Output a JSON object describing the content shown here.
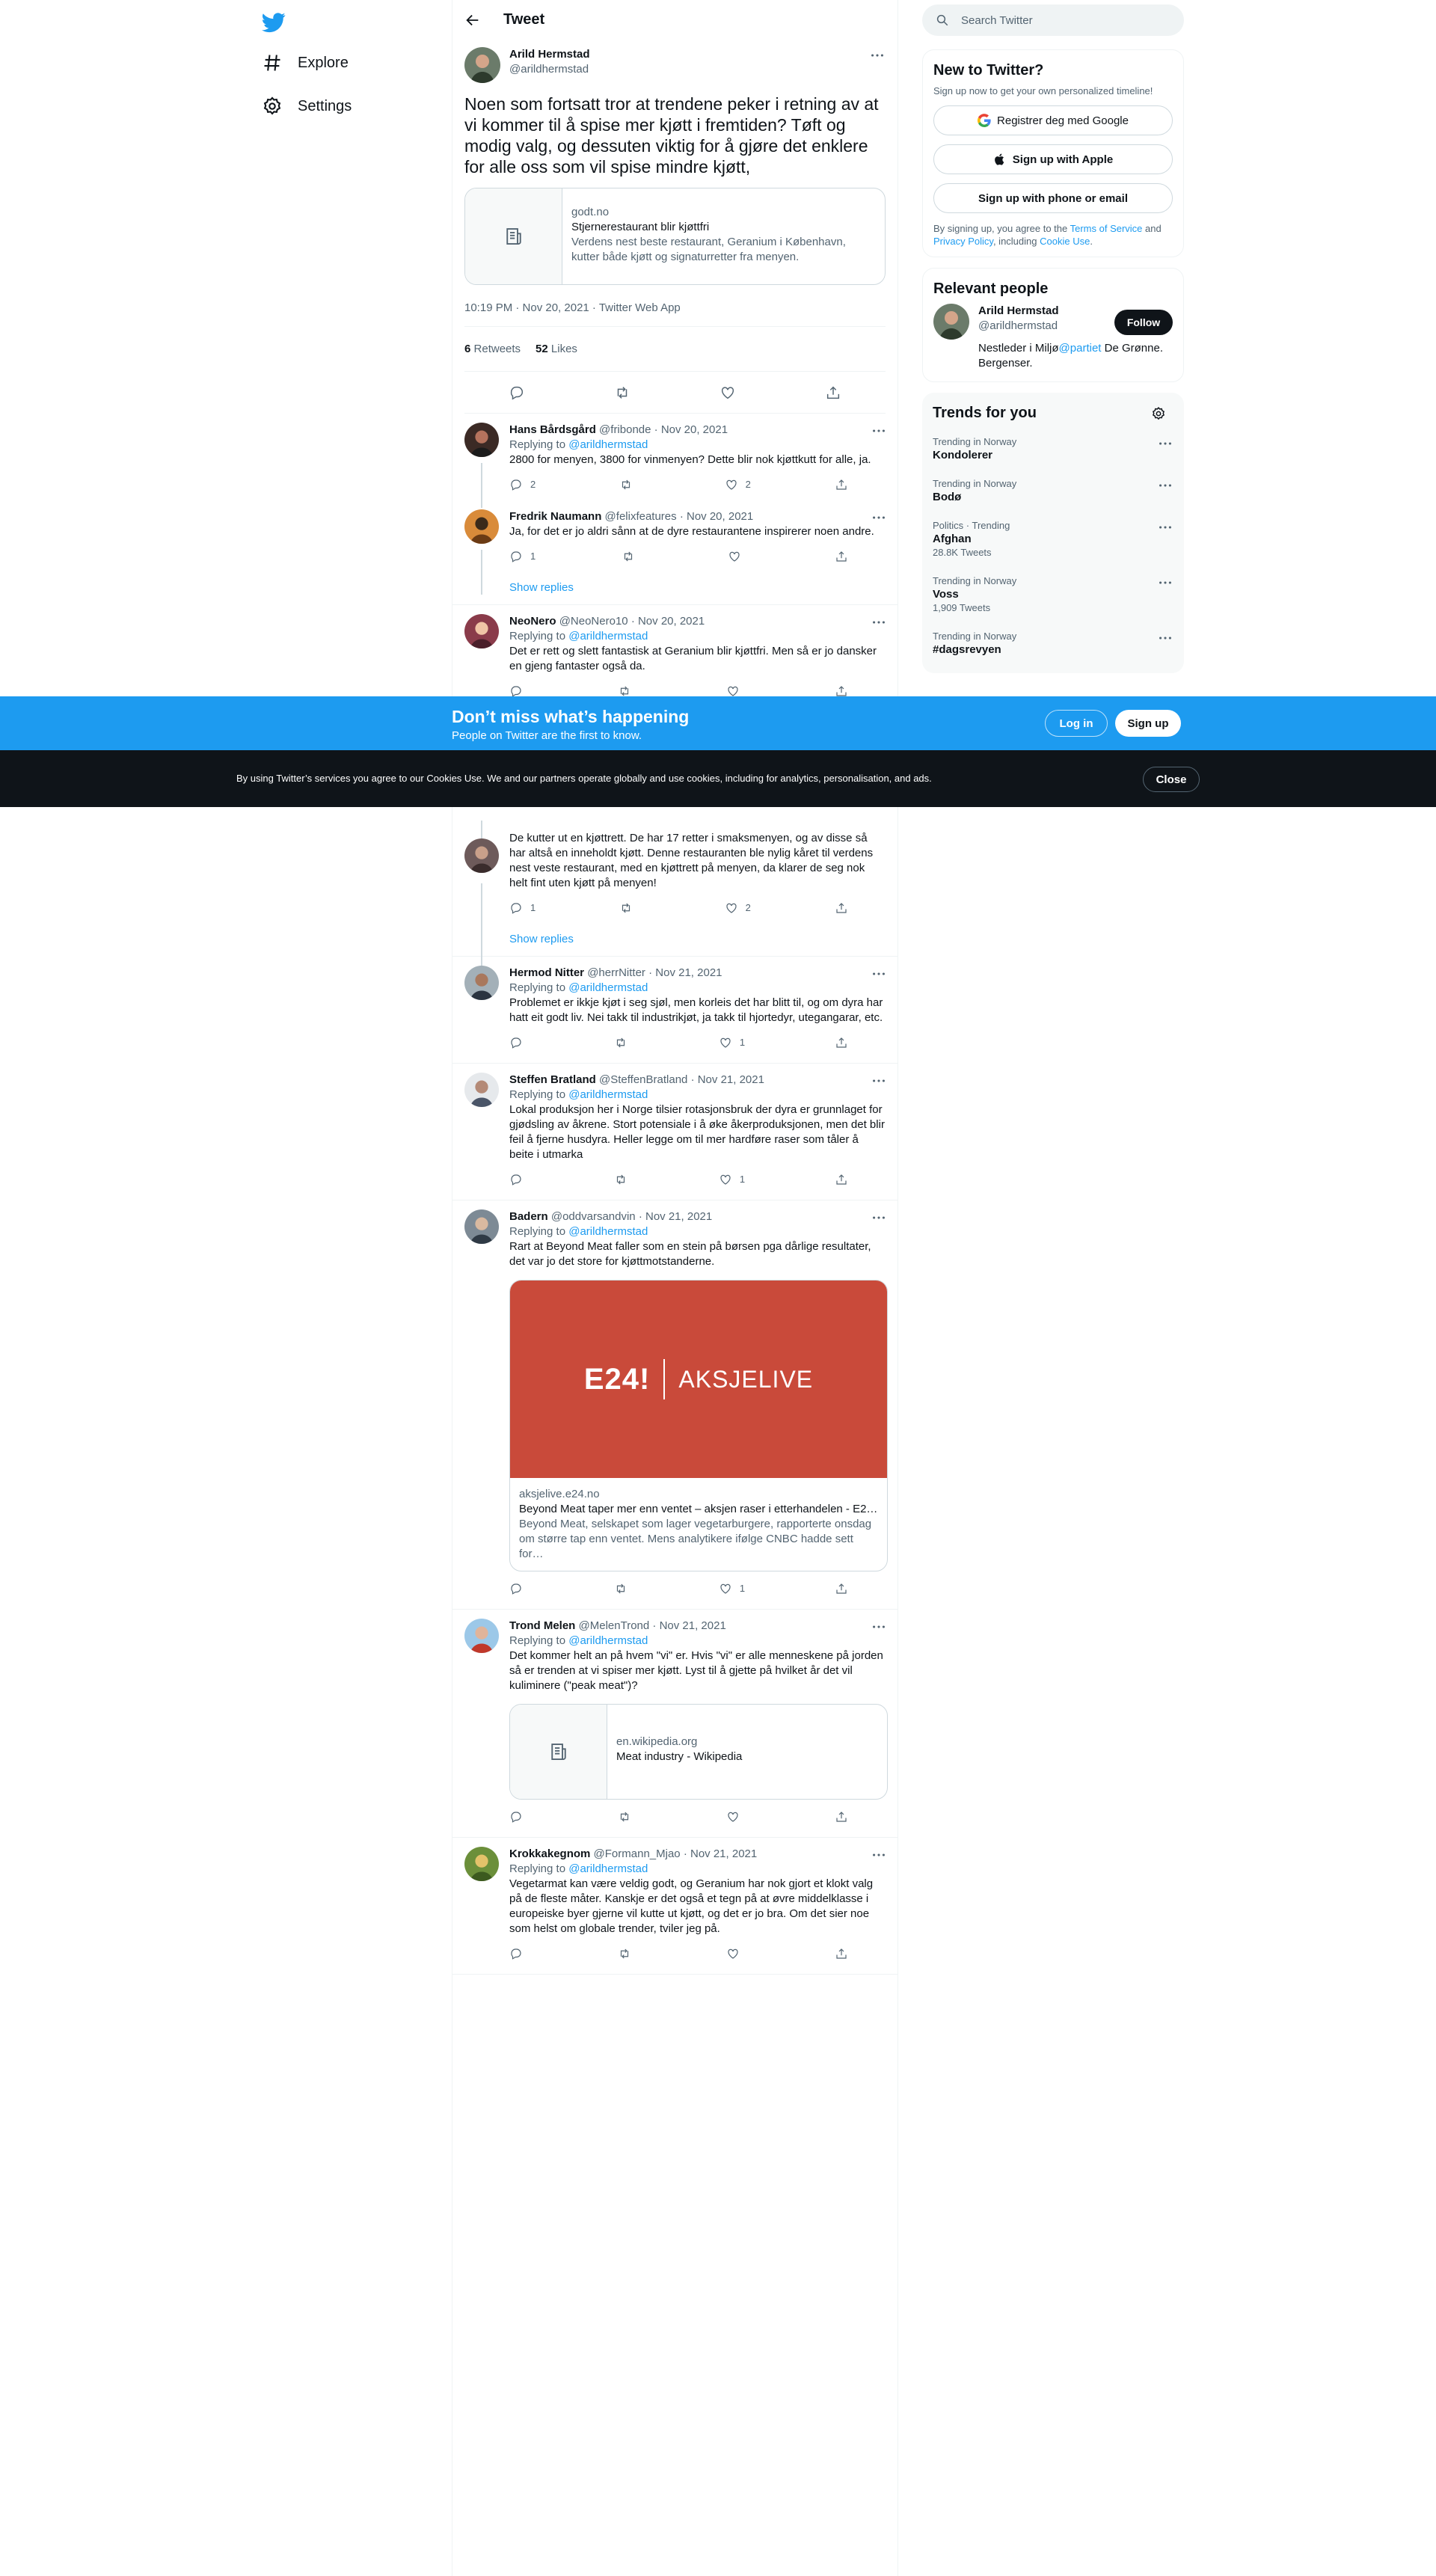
{
  "nav": {
    "explore": "Explore",
    "settings": "Settings"
  },
  "header": {
    "title": "Tweet"
  },
  "main_tweet": {
    "name": "Arild Hermstad",
    "handle": "@arildhermstad",
    "text": "Noen som fortsatt tror at trendene peker i retning av at vi kommer til å spise mer kjøtt i fremtiden? Tøft og modig valg, og dessuten viktig for å gjøre det enklere for alle oss som vil spise mindre kjøtt,",
    "card": {
      "domain": "godt.no",
      "title": "Stjernerestaurant blir kjøttfri",
      "desc": "Verdens nest beste restaurant, Geranium i København, kutter både kjøtt og signaturretter fra menyen."
    },
    "meta": "10:19 PM · Nov 20, 2021 · Twitter Web App",
    "retweets_count": "6",
    "retweets_label": "Retweets",
    "likes_count": "52",
    "likes_label": "Likes"
  },
  "replies": [
    {
      "name": "Hans Bårdsgård",
      "handle": "@fribonde",
      "date": "· Nov 20, 2021",
      "replying": "Replying to ",
      "to": "@arildhermstad",
      "text": "2800 for menyen, 3800 for vinmenyen? Dette blir nok kjøttkutt for alle, ja.",
      "replies": "2",
      "retweets": "",
      "likes": "2"
    },
    {
      "name": "Fredrik Naumann",
      "handle": "@felixfeatures",
      "date": "· Nov 20, 2021",
      "text": "Ja, for det er jo aldri sånn at  de dyre restaurantene inspirerer noen andre.",
      "replies": "1",
      "retweets": "",
      "likes": ""
    },
    {
      "name": "NeoNero",
      "handle": "@NeoNero10",
      "date": "· Nov 20, 2021",
      "replying": "Replying to ",
      "to": "@arildhermstad",
      "text": "Det er rett og slett fantastisk at Geranium blir kjøttfri. Men så er jo dansker en gjeng fantaster også da.",
      "replies": "",
      "retweets": "",
      "likes": ""
    },
    {
      "text": "De kutter ut en kjøttrett. De har 17 retter i smaksmenyen, og av disse så har altså en inneholdt kjøtt. Denne restauranten ble nylig kåret til verdens nest veste restaurant, med en kjøttrett på menyen, da klarer de seg nok helt fint uten kjøtt på menyen!",
      "replies": "1",
      "retweets": "",
      "likes": "2"
    },
    {
      "name": "Hermod Nitter",
      "handle": "@herrNitter",
      "date": "· Nov 21, 2021",
      "replying": "Replying to ",
      "to": "@arildhermstad",
      "text": "Problemet er ikkje kjøt i seg sjøl, men korleis det har blitt til, og om dyra har hatt eit godt liv. Nei takk til industrikjøt, ja takk til hjortedyr, utegangarar, etc.",
      "replies": "",
      "retweets": "",
      "likes": "1"
    },
    {
      "name": "Steffen Bratland",
      "handle": "@SteffenBratland",
      "date": "· Nov 21, 2021",
      "replying": "Replying to ",
      "to": "@arildhermstad",
      "text": "Lokal produksjon her i Norge tilsier rotasjonsbruk der dyra er grunnlaget for gjødsling av åkrene. Stort potensiale i å øke åkerproduksjonen, men det blir feil å fjerne husdyra. Heller legge om til mer hardføre raser som tåler å beite i utmarka",
      "replies": "",
      "retweets": "",
      "likes": "1"
    },
    {
      "name": "Badern",
      "handle": "@oddvarsandvin",
      "date": "· Nov 21, 2021",
      "replying": "Replying to ",
      "to": "@arildhermstad",
      "text": "Rart at Beyond Meat faller som en stein på børsen pga dårlige resultater, det var jo det store for kjøttmotstanderne.",
      "replies": "",
      "retweets": "",
      "likes": "1",
      "card": {
        "logo": "E24!",
        "logo2": "AKSJELIVE",
        "domain": "aksjelive.e24.no",
        "title": "Beyond Meat taper mer enn ventet – aksjen raser i etterhandelen - E2…",
        "desc": "Beyond Meat, selskapet som lager vegetarburgere, rapporterte onsdag om større tap enn ventet. Mens analytikere ifølge CNBC hadde sett for…"
      }
    },
    {
      "name": "Trond Melen",
      "handle": "@MelenTrond",
      "date": "· Nov 21, 2021",
      "replying": "Replying to ",
      "to": "@arildhermstad",
      "text": "Det kommer helt an på hvem \"vi\" er. Hvis \"vi\" er alle menneskene på jorden så er trenden at vi spiser mer kjøtt. Lyst til å gjette på hvilket år det vil kuliminere (\"peak meat\")?",
      "replies": "",
      "retweets": "",
      "likes": "",
      "card": {
        "domain": "en.wikipedia.org",
        "title": "Meat industry - Wikipedia"
      }
    },
    {
      "name": "Krokkakegnom",
      "handle": "@Formann_Mjao",
      "date": "· Nov 21, 2021",
      "replying": "Replying to ",
      "to": "@arildhermstad",
      "text": "Vegetarmat kan være veldig godt, og Geranium har nok gjort et klokt valg på de fleste måter. Kanskje er det også et tegn på at øvre middelklasse i europeiske byer gjerne vil kutte ut kjøtt, og det er jo bra. Om det sier noe som helst om globale trender, tviler jeg på.",
      "replies": "",
      "retweets": "",
      "likes": ""
    }
  ],
  "show_replies": "Show replies",
  "search": {
    "placeholder": "Search Twitter"
  },
  "new_to_twitter": {
    "title": "New to Twitter?",
    "sub": "Sign up now to get your own personalized timeline!",
    "google": "Registrer deg med Google",
    "apple": "Sign up with Apple",
    "phone": "Sign up with phone or email",
    "terms_1": "By signing up, you agree to the ",
    "terms_link": "Terms of Service",
    "terms_2": " and ",
    "privacy_link": "Privacy Policy",
    "terms_3": ", including ",
    "cookie_link": "Cookie Use",
    "terms_4": "."
  },
  "relevant": {
    "title": "Relevant people",
    "name": "Arild Hermstad",
    "handle": "@arildhermstad",
    "follow": "Follow",
    "bio_1": "Nestleder i Miljø",
    "bio_link": "@partiet",
    "bio_2": " De Grønne. Bergenser."
  },
  "trends": {
    "title": "Trends for you",
    "items": [
      {
        "cat": "Trending in Norway",
        "name": "Kondolerer",
        "count": ""
      },
      {
        "cat": "Trending in Norway",
        "name": "Bodø",
        "count": ""
      },
      {
        "cat": "Politics · Trending",
        "name": "Afghan",
        "count": "28.8K Tweets"
      },
      {
        "cat": "Trending in Norway",
        "name": "Voss",
        "count": "1,909 Tweets"
      },
      {
        "cat": "Trending in Norway",
        "name": "#dagsrevyen",
        "count": ""
      }
    ]
  },
  "banner": {
    "headline": "Don’t miss what’s happening",
    "sub": "People on Twitter are the first to know.",
    "login": "Log in",
    "signup": "Sign up"
  },
  "cookie": {
    "text": "By using Twitter’s services you agree to our Cookies Use. We and our partners operate globally and use cookies, including for analytics, personalisation, and ads.",
    "close": "Close"
  },
  "colors": {
    "accent": "#1d9bf0",
    "dark": "#0f1419",
    "muted": "#536471"
  }
}
